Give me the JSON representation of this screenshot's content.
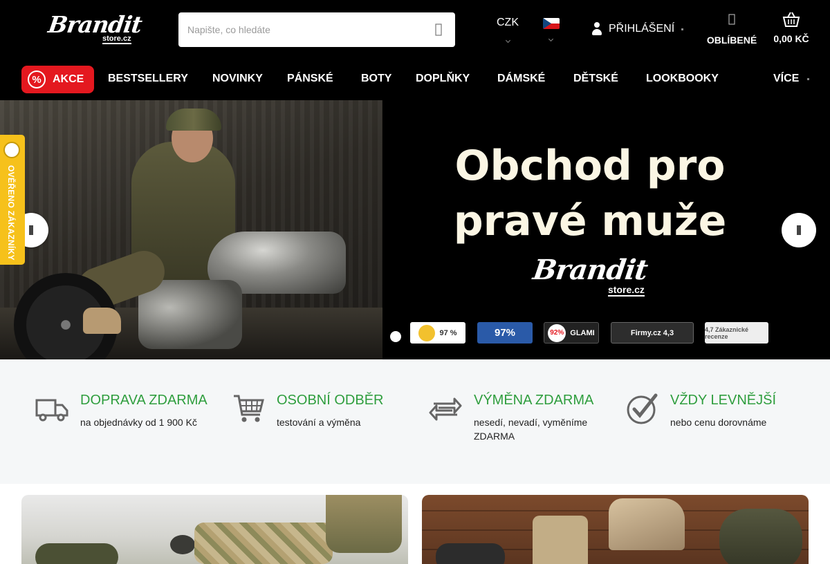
{
  "header": {
    "logo_text": "Brandit",
    "logo_sub": "store.cz",
    "search_placeholder": "Napište, co hledáte",
    "currency": "CZK",
    "login_label": "PŘIHLÁŠENÍ",
    "favorites_label": "OBLÍBENÉ",
    "cart_total": "0,00 KČ"
  },
  "nav": {
    "sale_label": "AKCE",
    "sale_icon": "%",
    "items": [
      "BESTSELLERY",
      "NOVINKY",
      "PÁNSKÉ",
      "BOTY",
      "DOPLŇKY",
      "DÁMSKÉ",
      "DĚTSKÉ",
      "LOOKBOOKY"
    ],
    "more_label": "VÍCE"
  },
  "hero": {
    "headline_line1": "Obchod pro",
    "headline_line2": "pravé muže",
    "logo_text": "Brandit",
    "logo_sub": "store.cz",
    "badges": {
      "heureka": "97 %",
      "recenze": "97%",
      "glami_pct": "92%",
      "glami_label": "GLAMI",
      "firmy": "Firmy.cz 4,3",
      "google": "4,7 Zákaznické recenze"
    },
    "verified_label": "OVĚŘENO ZÁKAZNÍKY"
  },
  "benefits": [
    {
      "title": "DOPRAVA ZDARMA",
      "desc": "na objednávky od 1 900 Kč",
      "icon": "truck-icon"
    },
    {
      "title": "OSOBNÍ ODBĚR",
      "desc": "testování a výměna",
      "icon": "cart-icon"
    },
    {
      "title": "VÝMĚNA ZDARMA",
      "desc": "nesedí, nevadí, vyměníme ZDARMA",
      "icon": "exchange-icon"
    },
    {
      "title": "VŽDY LEVNĚJŠÍ",
      "desc": "nebo cenu dorovnáme",
      "icon": "checkmark-icon"
    }
  ],
  "colors": {
    "accent_red": "#e4181f",
    "benefit_green": "#2f9e3e",
    "header_bg": "#000000",
    "verified_yellow": "#f6c11b"
  }
}
